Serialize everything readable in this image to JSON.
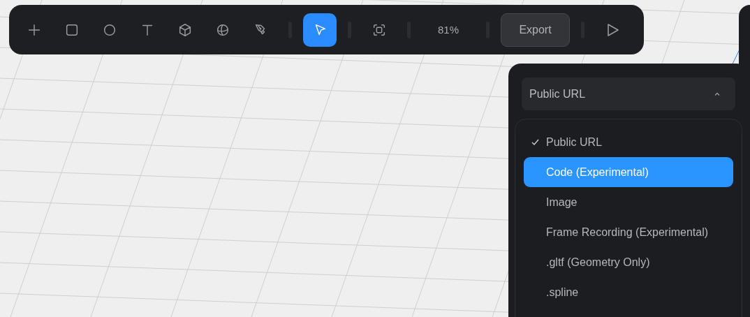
{
  "toolbar": {
    "tools": [
      {
        "kind": "add",
        "selected": false
      },
      {
        "kind": "rectangle",
        "selected": false
      },
      {
        "kind": "ellipse",
        "selected": false
      },
      {
        "kind": "text",
        "selected": false
      },
      {
        "kind": "cube",
        "selected": false
      },
      {
        "kind": "sphere",
        "selected": false
      },
      {
        "kind": "pen",
        "selected": false
      },
      {
        "kind": "select",
        "selected": true
      },
      {
        "kind": "frame",
        "selected": false
      }
    ],
    "zoom": "81%",
    "export_button": "Export",
    "play": {
      "kind": "play"
    }
  },
  "export_panel": {
    "format_select": {
      "value": "Public URL",
      "expanded": true
    },
    "options": [
      {
        "label": "Public URL",
        "checked": true,
        "highlighted": false
      },
      {
        "label": "Code (Experimental)",
        "checked": false,
        "highlighted": true
      },
      {
        "label": "Image",
        "checked": false,
        "highlighted": false
      },
      {
        "label": "Frame Recording (Experimental)",
        "checked": false,
        "highlighted": false
      },
      {
        "label": ".gltf (Geometry Only)",
        "checked": false,
        "highlighted": false
      },
      {
        "label": ".spline",
        "checked": false,
        "highlighted": false
      }
    ]
  }
}
